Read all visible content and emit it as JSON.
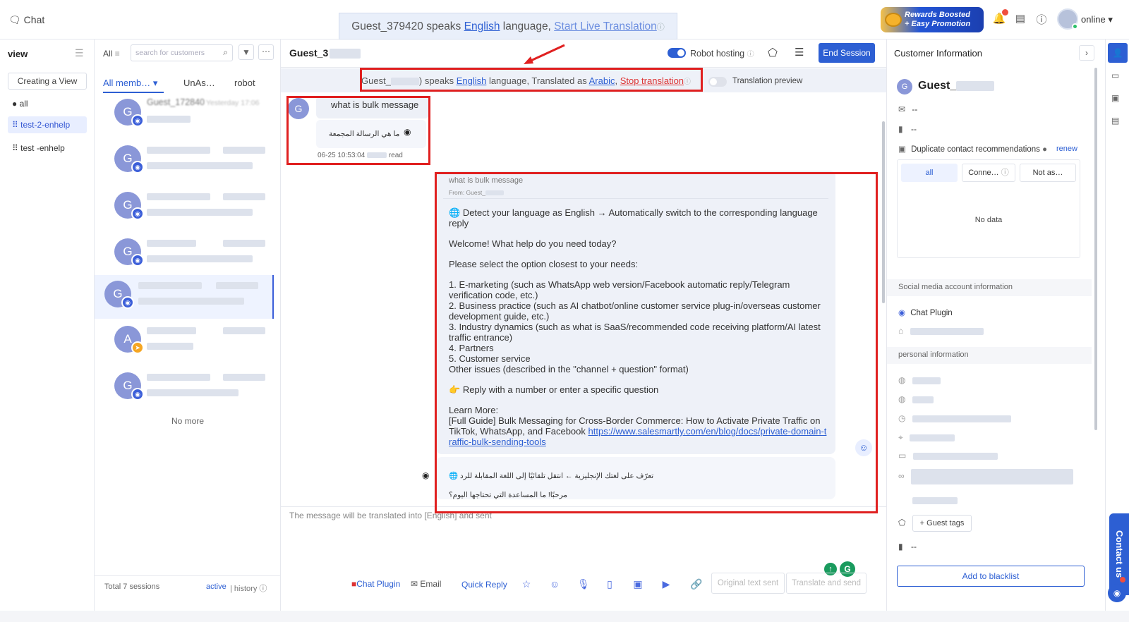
{
  "topbar": {
    "chat_label": "Chat",
    "online_label": "online",
    "rewards_line1": "Rewards Boosted",
    "rewards_line2": "+ Easy Promotion"
  },
  "banner": {
    "guest": "Guest_379420",
    "speaks": " speaks ",
    "language": "English",
    "language_suffix": " language, ",
    "action": "Start Live Translation"
  },
  "sidebar": {
    "title": "view",
    "create_view": "Creating a View",
    "items": [
      {
        "label": "all"
      },
      {
        "label": "test-2-enhelp"
      },
      {
        "label": "test -enhelp"
      }
    ]
  },
  "customer_list": {
    "filter_all": "All",
    "search_placeholder": "search for customers",
    "tabs": [
      "All memb…",
      "UnAs…",
      "robot"
    ],
    "first_name": "Guest_172840",
    "first_time": "Yesterday 17:06",
    "no_more": "No more",
    "total": "Total 7 sessions",
    "active_label": "active",
    "history_label": "history"
  },
  "chat": {
    "guest_title": "Guest_3",
    "robot_hosting": "Robot hosting",
    "end_session": "End Session",
    "translation_bar": {
      "guest": "Guest_",
      "speaks": " speaks ",
      "language": "English",
      "middle": " language, Translated as ",
      "target": "Arabic",
      "comma": ", ",
      "stop": "Stop translation",
      "preview": "Translation preview"
    },
    "incoming": {
      "text": "what is bulk message",
      "translated": "ما هي الرسالة المجمعة",
      "time": "06-25 10:53:04",
      "read": "read"
    },
    "reply": {
      "quote": "what is bulk message",
      "from": "From: Guest_",
      "detect": "Detect your language as English → Automatically switch to the corresponding language reply",
      "welcome": "Welcome! What help do you need today?",
      "select": "Please select the option closest to your needs:",
      "options": [
        "1. E-marketing (such as WhatsApp web version/Facebook automatic reply/Telegram verification code, etc.)",
        "2. Business practice (such as AI chatbot/online customer service plug-in/overseas customer development guide, etc.)",
        "3. Industry dynamics (such as what is SaaS/recommended code receiving platform/AI latest traffic entrance)",
        "4. Partners",
        "5. Customer service",
        "Other issues (described in the \"channel + question\" format)"
      ],
      "reply_hint": "Reply with a number or enter a specific question",
      "learn_more": "Learn More:",
      "guide_text": "[Full Guide] Bulk Messaging for Cross-Border Commerce: How to Activate Private Traffic on TikTok, WhatsApp, and Facebook ",
      "guide_link": "https://www.salesmartly.com/en/blog/docs/private-domain-traffic-bulk-sending-tools",
      "arabic_1": "تعرّف على لغتك الإنجليزية ← انتقل تلقائيًا إلى اللغة المقابلة للرد",
      "arabic_2": "مرحبًا! ما المساعدة التي تحتاجها اليوم؟"
    },
    "input_placeholder": "The message will be translated into [English] and sent",
    "toolbar": {
      "chat_plugin": "Chat Plugin",
      "email": "Email",
      "quick_reply": "Quick Reply",
      "original_sent": "Original text sent",
      "translate_send": "Translate and send"
    }
  },
  "customer_info": {
    "title": "Customer Information",
    "name": "Guest_",
    "email": "--",
    "phone": "--",
    "duplicate": "Duplicate contact recommendations",
    "renew": "renew",
    "dup_tabs": [
      "all",
      "Conne…",
      "Not as…"
    ],
    "no_data": "No data",
    "social_title": "Social media account information",
    "chat_plugin": "Chat Plugin",
    "personal_title": "personal information",
    "guest_tags": "+ Guest tags",
    "bottom_value": "--",
    "blacklist": "Add to blacklist"
  },
  "contact_us": "Contact us"
}
